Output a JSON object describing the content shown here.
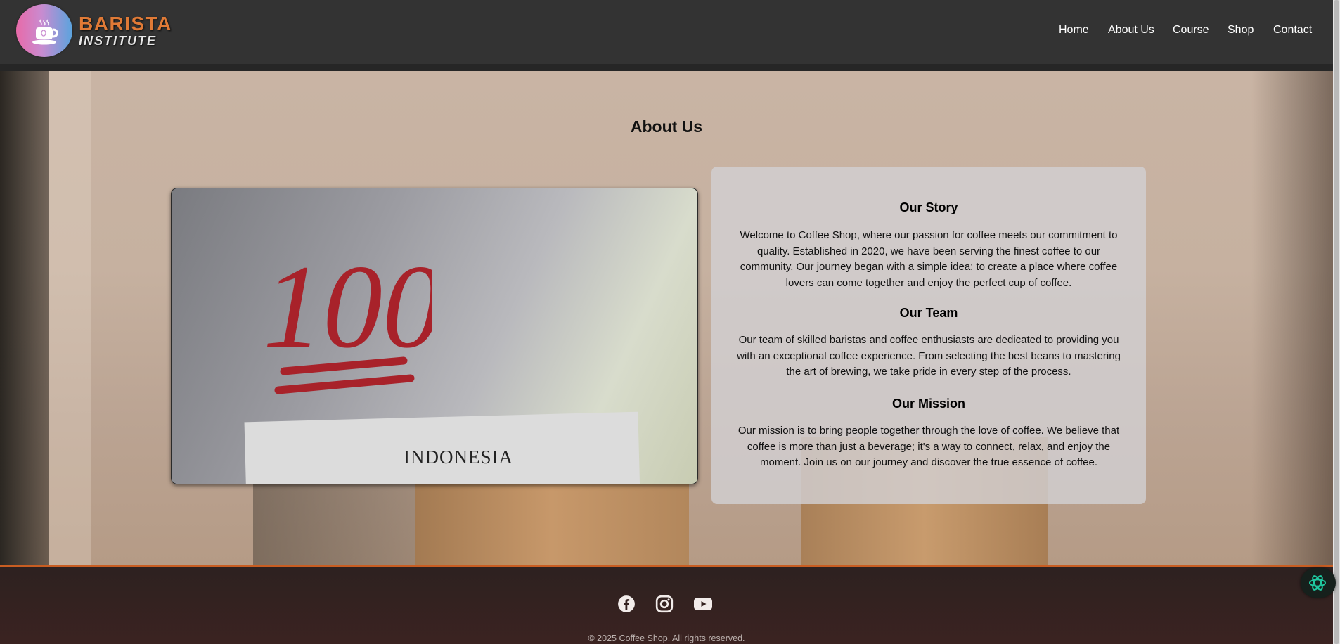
{
  "brand": {
    "line1": "BARISTA",
    "line2": "INSTITUTE",
    "logo_icon": "coffee-cup-icon"
  },
  "nav": {
    "items": [
      {
        "label": "Home"
      },
      {
        "label": "About Us"
      },
      {
        "label": "Course"
      },
      {
        "label": "Shop"
      },
      {
        "label": "Contact"
      }
    ]
  },
  "page": {
    "title": "About Us"
  },
  "photo": {
    "number": "100",
    "text": "INDONESIA"
  },
  "sections": [
    {
      "heading": "Our Story",
      "body": "Welcome to Coffee Shop, where our passion for coffee meets our commitment to quality. Established in 2020, we have been serving the finest coffee to our community. Our journey began with a simple idea: to create a place where coffee lovers can come together and enjoy the perfect cup of coffee."
    },
    {
      "heading": "Our Team",
      "body": "Our team of skilled baristas and coffee enthusiasts are dedicated to providing you with an exceptional coffee experience. From selecting the best beans to mastering the art of brewing, we take pride in every step of the process."
    },
    {
      "heading": "Our Mission",
      "body": "Our mission is to bring people together through the love of coffee. We believe that coffee is more than just a beverage; it's a way to connect, relax, and enjoy the moment. Join us on our journey and discover the true essence of coffee."
    }
  ],
  "footer": {
    "social": [
      "facebook-icon",
      "instagram-icon",
      "youtube-icon"
    ],
    "copyright": "© 2025 Coffee Shop. All rights reserved."
  },
  "colors": {
    "brand_orange": "#e07a36",
    "footer_accent": "#c85d22",
    "header_bg": "#333333"
  }
}
